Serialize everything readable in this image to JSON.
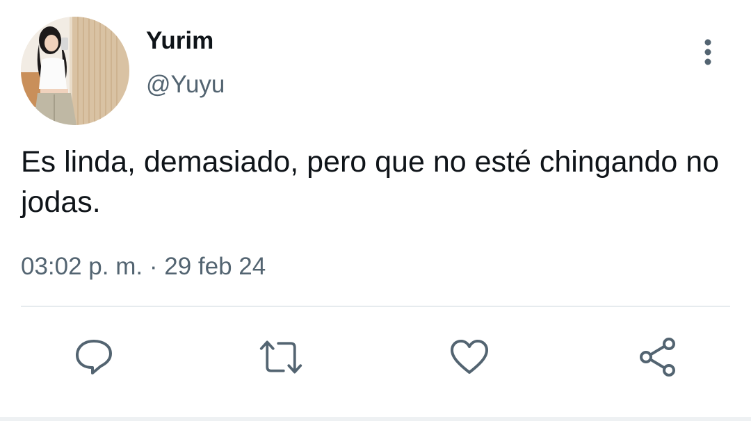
{
  "tweet": {
    "display_name": "Yurim",
    "handle": "@Yuyu",
    "text": "Es linda, demasiado, pero que no esté chingando no jodas.",
    "time": "03:02 p. m.",
    "separator": "·",
    "date": "29 feb 24"
  },
  "actions": {
    "reply_icon": "reply-icon",
    "retweet_icon": "retweet-icon",
    "like_icon": "heart-icon",
    "share_icon": "share-icon",
    "more_icon": "more-vertical-icon"
  },
  "colors": {
    "text_primary": "#0f1419",
    "text_secondary": "#536471",
    "icon": "#536471",
    "divider": "#e6ebee"
  }
}
